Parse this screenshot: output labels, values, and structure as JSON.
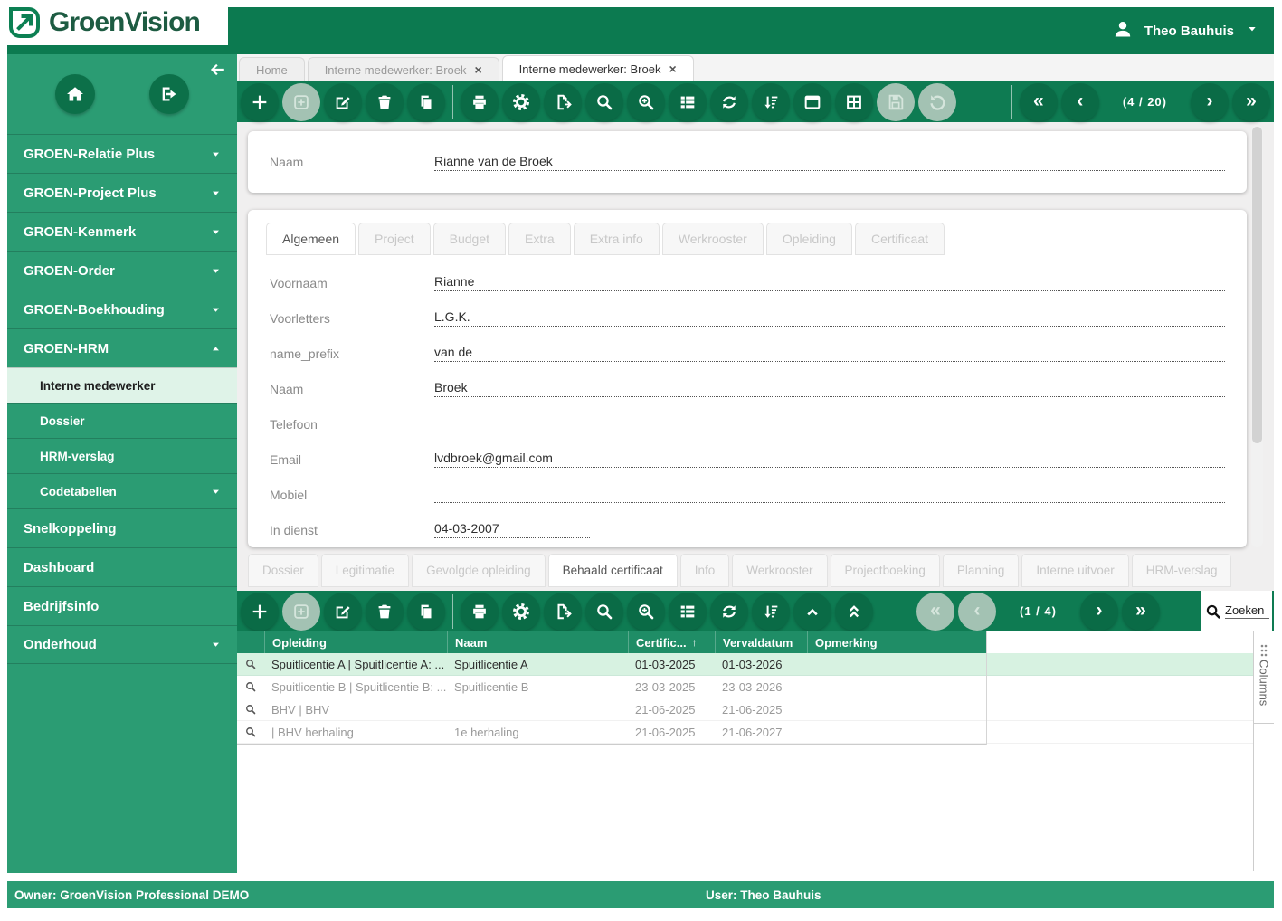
{
  "brand": {
    "logo_text": "GroenVision",
    "accent_dark": "#0C7A50",
    "accent_mid": "#2B9C73"
  },
  "header": {
    "user_name": "Theo Bauhuis"
  },
  "sidebar": {
    "items": [
      {
        "label": "GROEN-Relatie Plus",
        "type": "top",
        "chevron": "down"
      },
      {
        "label": "GROEN-Project Plus",
        "type": "top",
        "chevron": "down"
      },
      {
        "label": "GROEN-Kenmerk",
        "type": "top",
        "chevron": "down"
      },
      {
        "label": "GROEN-Order",
        "type": "top",
        "chevron": "down"
      },
      {
        "label": "GROEN-Boekhouding",
        "type": "top",
        "chevron": "down"
      },
      {
        "label": "GROEN-HRM",
        "type": "top",
        "chevron": "up"
      },
      {
        "label": "Interne medewerker",
        "type": "sub",
        "active": true
      },
      {
        "label": "Dossier",
        "type": "sub"
      },
      {
        "label": "HRM-verslag",
        "type": "sub"
      },
      {
        "label": "Codetabellen",
        "type": "sub",
        "chevron": "down"
      },
      {
        "label": "Snelkoppeling",
        "type": "top"
      },
      {
        "label": "Dashboard",
        "type": "top"
      },
      {
        "label": "Bedrijfsinfo",
        "type": "top"
      },
      {
        "label": "Onderhoud",
        "type": "top",
        "chevron": "down"
      }
    ]
  },
  "window_tabs": [
    {
      "label": "Home",
      "active": false,
      "closable": false
    },
    {
      "label": "Interne medewerker: Broek",
      "active": false,
      "closable": true
    },
    {
      "label": "Interne medewerker: Broek",
      "active": true,
      "closable": true
    }
  ],
  "toolbar_top": {
    "buttons": [
      {
        "icon": "plus"
      },
      {
        "icon": "add-box",
        "disabled": true
      },
      {
        "icon": "edit"
      },
      {
        "icon": "trash"
      },
      {
        "icon": "copy"
      },
      {
        "divider": true
      },
      {
        "icon": "print"
      },
      {
        "icon": "gear"
      },
      {
        "icon": "export"
      },
      {
        "icon": "search"
      },
      {
        "icon": "zoom-in"
      },
      {
        "icon": "list"
      },
      {
        "icon": "refresh"
      },
      {
        "icon": "sort"
      },
      {
        "icon": "window"
      },
      {
        "icon": "grid"
      },
      {
        "icon": "save",
        "disabled": true
      },
      {
        "icon": "undo",
        "disabled": true
      }
    ],
    "nav": [
      {
        "divider": true
      },
      {
        "glyph": "«",
        "name": "first"
      },
      {
        "glyph": "‹",
        "name": "prev"
      },
      {
        "pager": true
      },
      {
        "glyph": "›",
        "name": "next"
      },
      {
        "glyph": "»",
        "name": "last"
      }
    ],
    "pager_text": "(4 / 20)"
  },
  "record_form": {
    "header_field": {
      "label": "Naam",
      "value": "Rianne van de Broek"
    },
    "tabs": [
      "Algemeen",
      "Project",
      "Budget",
      "Extra",
      "Extra info",
      "Werkrooster",
      "Opleiding",
      "Certificaat"
    ],
    "active_tab": "Algemeen",
    "fields": [
      {
        "label": "Voornaam",
        "value": "Rianne"
      },
      {
        "label": "Voorletters",
        "value": "L.G.K."
      },
      {
        "label": "name_prefix",
        "value": "van de"
      },
      {
        "label": "Naam",
        "value": "Broek"
      },
      {
        "label": "Telefoon",
        "value": ""
      },
      {
        "label": "Email",
        "value": "lvdbroek@gmail.com"
      },
      {
        "label": "Mobiel",
        "value": ""
      },
      {
        "label": "In dienst",
        "value": "04-03-2007",
        "short": true
      }
    ]
  },
  "detail_tabs": [
    "Dossier",
    "Legitimatie",
    "Gevolgde opleiding",
    "Behaald certificaat",
    "Info",
    "Werkrooster",
    "Projectboeking",
    "Planning",
    "Interne uitvoer",
    "HRM-verslag"
  ],
  "detail_active_tab": "Behaald certificaat",
  "toolbar_bottom": {
    "buttons": [
      {
        "icon": "plus"
      },
      {
        "icon": "add-box",
        "disabled": true
      },
      {
        "icon": "edit"
      },
      {
        "icon": "trash"
      },
      {
        "icon": "copy"
      },
      {
        "divider": true
      },
      {
        "icon": "print"
      },
      {
        "icon": "gear"
      },
      {
        "icon": "export"
      },
      {
        "icon": "search"
      },
      {
        "icon": "zoom-in"
      },
      {
        "icon": "list"
      },
      {
        "icon": "refresh"
      },
      {
        "icon": "sort"
      },
      {
        "icon": "chevron-up"
      },
      {
        "icon": "chevrons-up"
      }
    ],
    "nav": [
      {
        "glyph": "«",
        "name": "first",
        "disabled": true
      },
      {
        "glyph": "‹",
        "name": "prev",
        "disabled": true
      },
      {
        "pager": true
      },
      {
        "glyph": "›",
        "name": "next"
      },
      {
        "glyph": "»",
        "name": "last"
      }
    ],
    "pager_text": "(1 / 4)",
    "search_label": "Zoeken"
  },
  "grid": {
    "columns": [
      "Opleiding",
      "Naam",
      "Certific...",
      "Vervaldatum",
      "Opmerking"
    ],
    "sort_col_index": 2,
    "sort_dir": "asc",
    "row_keys": [
      "opleiding",
      "naam",
      "certific",
      "vervaldatum",
      "opmerking"
    ],
    "rows": [
      {
        "opleiding": "Spuitlicentie A | Spuitlicentie A: ...",
        "naam": "Spuitlicentie A",
        "certific": "01-03-2025",
        "vervaldatum": "01-03-2026",
        "opmerking": "",
        "selected": true
      },
      {
        "opleiding": "Spuitlicentie B | Spuitlicentie B: ...",
        "naam": "Spuitlicentie B",
        "certific": "23-03-2025",
        "vervaldatum": "23-03-2026",
        "opmerking": ""
      },
      {
        "opleiding": "BHV | BHV",
        "naam": "",
        "certific": "21-06-2025",
        "vervaldatum": "21-06-2025",
        "opmerking": ""
      },
      {
        "opleiding": "| BHV herhaling",
        "naam": "1e herhaling",
        "certific": "21-06-2025",
        "vervaldatum": "21-06-2027",
        "opmerking": ""
      }
    ],
    "columns_button": "Columns"
  },
  "footer": {
    "owner": "Owner: GroenVision Professional DEMO",
    "user": "User: Theo Bauhuis"
  }
}
